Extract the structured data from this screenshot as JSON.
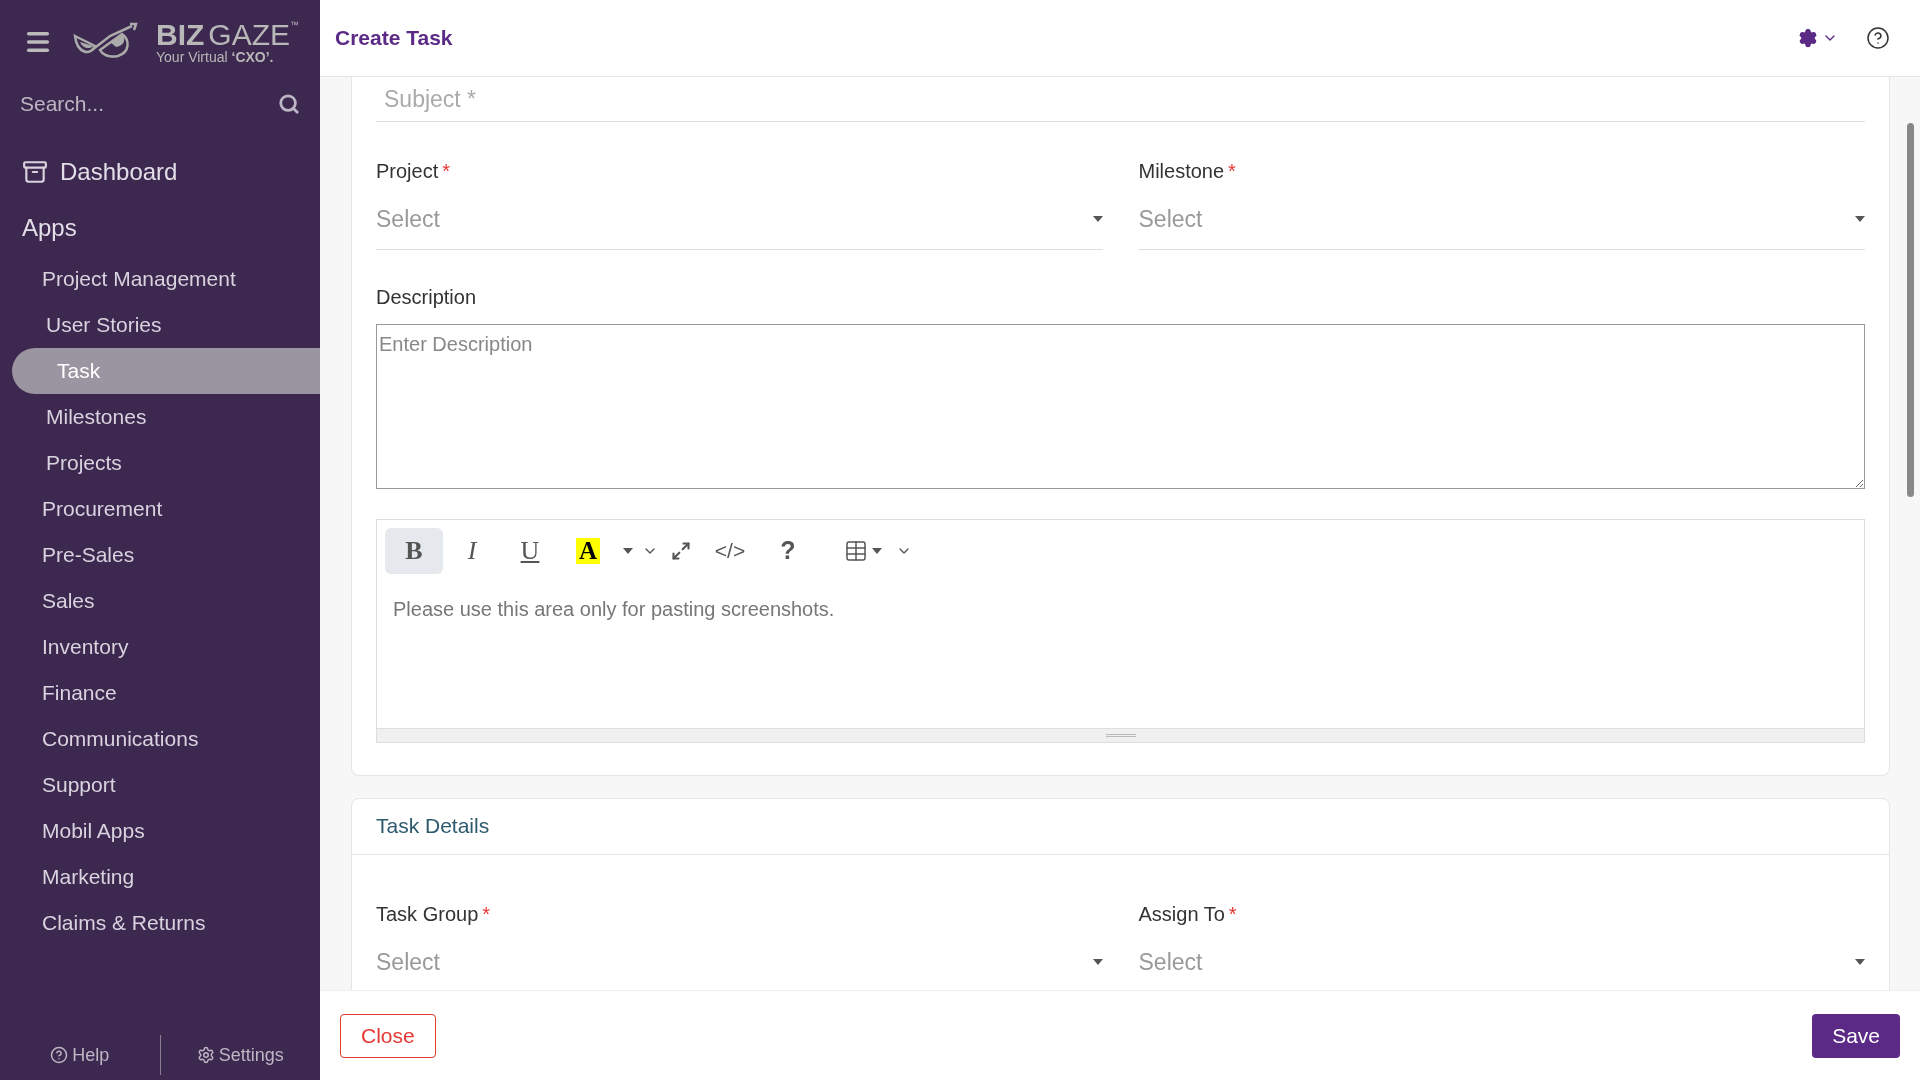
{
  "sidebar": {
    "logo": {
      "bold": "BIZ",
      "name": "GAZE",
      "mark": "™",
      "tagline": "Your Virtual **‘CXO’.**"
    },
    "search": {
      "placeholder": "Search..."
    },
    "dashboard": "Dashboard",
    "section": "Apps",
    "items": [
      {
        "label": "Project Management",
        "selected": false,
        "children": [
          {
            "label": "User Stories",
            "selected": false
          },
          {
            "label": "Task",
            "selected": true
          },
          {
            "label": "Milestones",
            "selected": false
          },
          {
            "label": "Projects",
            "selected": false
          }
        ]
      },
      {
        "label": "Procurement",
        "selected": false
      },
      {
        "label": "Pre-Sales",
        "selected": false
      },
      {
        "label": "Sales",
        "selected": false
      },
      {
        "label": "Inventory",
        "selected": false
      },
      {
        "label": "Finance",
        "selected": false
      },
      {
        "label": "Communications",
        "selected": false
      },
      {
        "label": "Support",
        "selected": false
      },
      {
        "label": "Mobil Apps",
        "selected": false
      },
      {
        "label": "Marketing",
        "selected": false
      },
      {
        "label": "Claims & Returns",
        "selected": false
      }
    ],
    "footer": [
      {
        "kind": "help",
        "label": "Help"
      },
      {
        "kind": "settings",
        "label": "Settings"
      }
    ]
  },
  "header": {
    "title": "Create Task"
  },
  "form": {
    "subject": {
      "placeholder": "Subject *"
    },
    "fields": [
      {
        "label": "Project",
        "required_mark": "*",
        "value": "Select"
      },
      {
        "label": "Milestone",
        "required_mark": "*",
        "value": "Select"
      }
    ],
    "description": {
      "label": "Description",
      "placeholder": "Enter Description"
    },
    "editor": {
      "placeholder": "Please use this area only for pasting screenshots.",
      "toolbar": [
        {
          "kind": "bold",
          "label": "B",
          "active": true
        },
        {
          "kind": "italic",
          "label": "I",
          "active": false
        },
        {
          "kind": "underline",
          "label": "U",
          "active": false
        },
        {
          "kind": "color",
          "label": "A",
          "active": false
        },
        {
          "kind": "caret",
          "active": false
        },
        {
          "kind": "chevron",
          "active": false
        },
        {
          "kind": "expand",
          "active": false
        },
        {
          "kind": "code",
          "label": "</>",
          "active": false
        },
        {
          "kind": "help",
          "label": "?",
          "active": false
        },
        {
          "kind": "table",
          "active": false
        },
        {
          "kind": "chevron",
          "active": false
        }
      ]
    }
  },
  "task_details": {
    "title": "Task Details",
    "fields": [
      {
        "label": "Task Group",
        "required_mark": "*",
        "value": "Select"
      },
      {
        "label": "Assign To",
        "required_mark": "*",
        "value": "Select"
      }
    ]
  },
  "buttons": [
    {
      "kind": "close",
      "label": "Close"
    },
    {
      "kind": "save",
      "label": "Save"
    }
  ]
}
